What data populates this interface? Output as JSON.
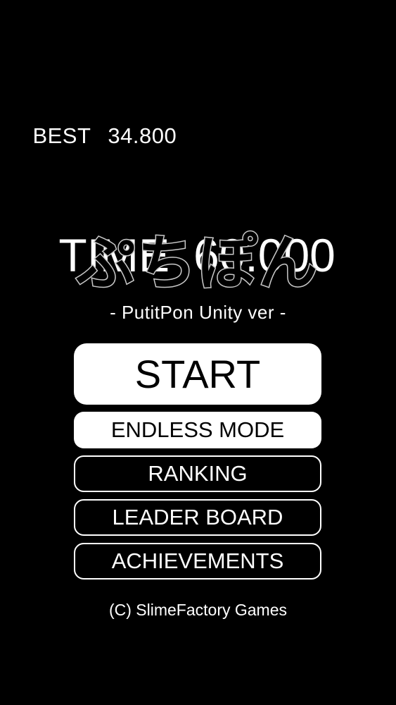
{
  "score": {
    "best_label": "BEST",
    "best_value": "34.800",
    "time_label": "TIME",
    "time_value": "60.000"
  },
  "logo": {
    "title": "ぷちぽん",
    "subtitle": "- PutitPon Unity ver -"
  },
  "menu": {
    "start": "START",
    "endless": "ENDLESS MODE",
    "ranking": "RANKING",
    "leader_board": "LEADER BOARD",
    "achievements": "ACHIEVEMENTS"
  },
  "footer": {
    "copyright": "(C) SlimeFactory Games"
  },
  "colors": {
    "background": "#000000",
    "foreground": "#ffffff",
    "logo_outline": "#c8c8c8"
  }
}
